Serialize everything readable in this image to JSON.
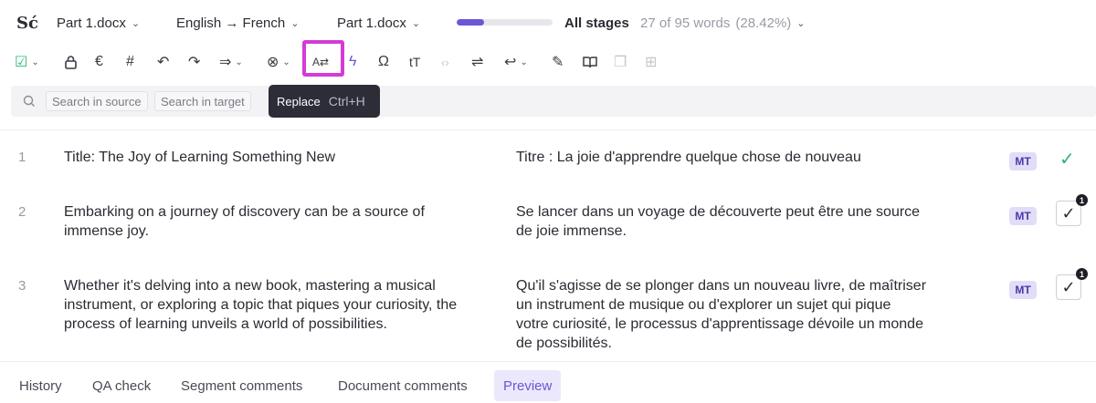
{
  "header": {
    "logo": "Sć",
    "file_left": "Part 1.docx",
    "language_pair": "English → French",
    "file_right": "Part 1.docx",
    "progress_fraction": 0.2842,
    "stages_label": "All stages",
    "words_progress": "27 of 95 words",
    "words_percent": "(28.42%)"
  },
  "toolbar": {
    "items": [
      {
        "icon": "confirm-check-icon",
        "glyph": "☑"
      },
      {
        "icon": "lock-icon",
        "glyph": "🔒"
      },
      {
        "icon": "euro-icon",
        "glyph": "€"
      },
      {
        "icon": "hash-icon",
        "glyph": "#"
      },
      {
        "icon": "undo-icon",
        "glyph": "↶"
      },
      {
        "icon": "redo-icon",
        "glyph": "↷"
      },
      {
        "icon": "copy-source-icon",
        "glyph": "⇒"
      },
      {
        "icon": "clear-icon",
        "glyph": "⊗"
      },
      {
        "icon": "replace-icon",
        "glyph": "A⇄"
      },
      {
        "icon": "lightning-icon",
        "glyph": "ϟ"
      },
      {
        "icon": "omega-icon",
        "glyph": "Ω"
      },
      {
        "icon": "text-case-icon",
        "glyph": "tT"
      },
      {
        "icon": "code-icon",
        "glyph": "‹›"
      },
      {
        "icon": "merge-icon",
        "glyph": "⇌"
      },
      {
        "icon": "revert-icon",
        "glyph": "↩"
      },
      {
        "icon": "feather-icon",
        "glyph": "✎"
      },
      {
        "icon": "book-icon",
        "glyph": "📖"
      },
      {
        "icon": "copy-icon",
        "glyph": "❐"
      },
      {
        "icon": "split-icon",
        "glyph": "⊞"
      }
    ]
  },
  "search": {
    "source_placeholder": "Search in source",
    "target_placeholder": "Search in target"
  },
  "tooltip": {
    "label": "Replace",
    "shortcut": "Ctrl+H"
  },
  "segments": [
    {
      "number": "1",
      "source": "Title: The Joy of Learning Something New",
      "target": "Titre : La joie d'apprendre quelque chose de nouveau",
      "badge": "MT",
      "status": "confirmed",
      "count": ""
    },
    {
      "number": "2",
      "source": "Embarking on a journey of discovery can be a source of immense joy.",
      "target": "Se lancer dans un voyage de découverte peut être une source de joie immense.",
      "badge": "MT",
      "status": "pending",
      "count": "1"
    },
    {
      "number": "3",
      "source": "Whether it's delving into a new book, mastering a musical instrument, or exploring a topic that piques your curiosity, the process of learning unveils a world of possibilities.",
      "target": "Qu'il s'agisse de se plonger dans un nouveau livre, de maîtriser un instrument de musique ou d'explorer un sujet qui pique votre curiosité, le processus d'apprentissage dévoile un monde de possibilités.",
      "badge": "MT",
      "status": "pending",
      "count": "1"
    }
  ],
  "bottom_tabs": [
    "History",
    "QA check",
    "Segment comments",
    "Document comments",
    "Preview"
  ],
  "active_tab": "Preview",
  "colors": {
    "accent": "#6b56d6",
    "confirmed": "#2bb673",
    "highlight": "#d43bd8"
  }
}
